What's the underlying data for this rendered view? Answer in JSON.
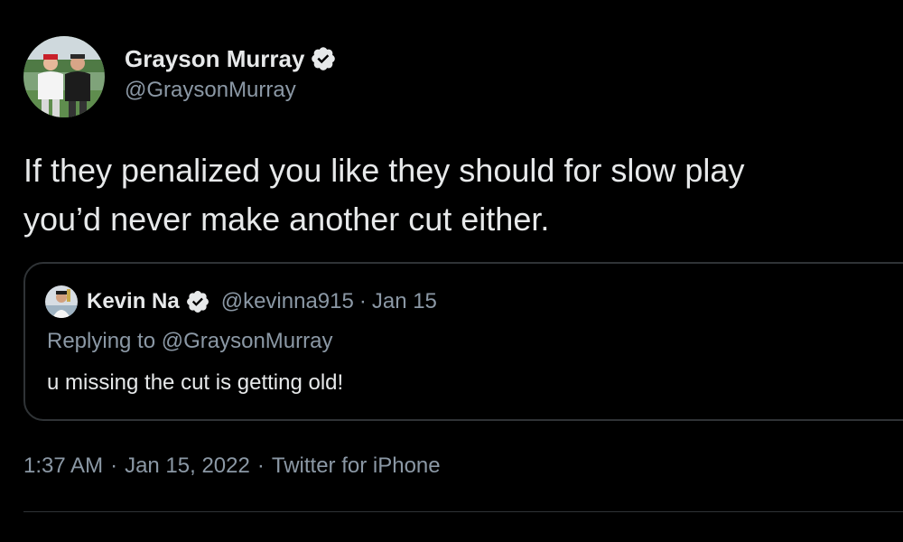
{
  "tweet": {
    "author": {
      "display_name": "Grayson Murray",
      "handle": "@GraysonMurray",
      "verified": true
    },
    "text_lines": [
      "If they penalized you like they should for slow play",
      "you’d never make another cut either."
    ],
    "quoted": {
      "author": {
        "display_name": "Kevin Na",
        "handle": "@kevinna915",
        "verified": true
      },
      "separator": "·",
      "date": "Jan 15",
      "replying_to": "Replying to @GraysonMurray",
      "text": "u missing the cut is getting old!"
    },
    "meta": {
      "time": "1:37 AM",
      "separator": "·",
      "date": "Jan 15, 2022",
      "source": "Twitter for iPhone"
    }
  },
  "colors": {
    "background": "#000000",
    "primary_text": "#e7e9ea",
    "secondary_text": "#8b98a5",
    "border": "#2f3336",
    "verified_badge": "#e7e9ea"
  },
  "icons": {
    "verified": "verified-badge-icon"
  }
}
